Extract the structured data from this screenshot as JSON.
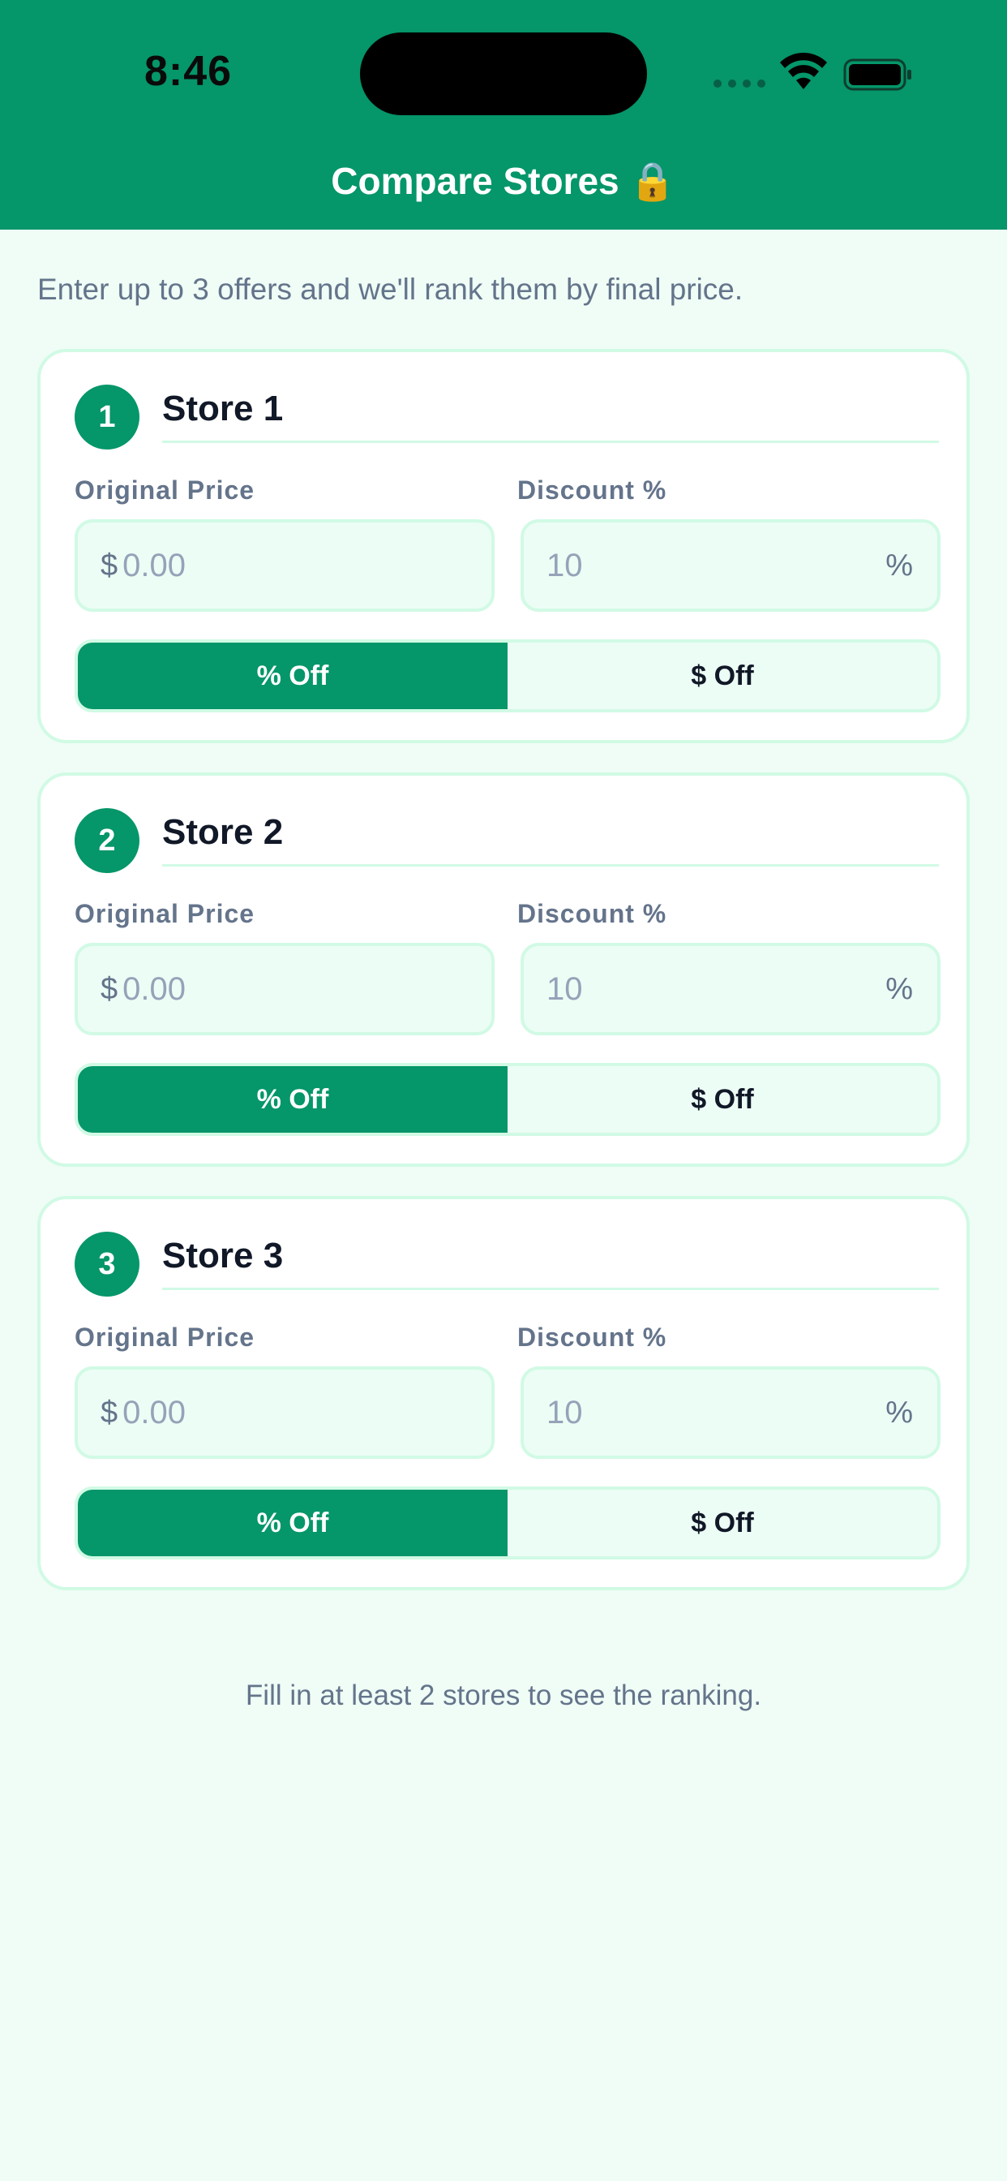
{
  "status_bar": {
    "time": "8:46"
  },
  "nav": {
    "title": "Compare Stores 🔒"
  },
  "intro": "Enter up to 3 offers and we'll rank them by final price.",
  "stores": [
    {
      "number": "1",
      "name": "Store 1",
      "price_label": "Original Price",
      "price_prefix": "$",
      "price_placeholder": "0.00",
      "discount_label": "Discount %",
      "discount_placeholder": "10",
      "discount_suffix": "%",
      "toggle": [
        "% Off",
        "$ Off"
      ],
      "selected_toggle": "% Off"
    },
    {
      "number": "2",
      "name": "Store 2",
      "price_label": "Original Price",
      "price_prefix": "$",
      "price_placeholder": "0.00",
      "discount_label": "Discount %",
      "discount_placeholder": "10",
      "discount_suffix": "%",
      "toggle": [
        "% Off",
        "$ Off"
      ],
      "selected_toggle": "% Off"
    },
    {
      "number": "3",
      "name": "Store 3",
      "price_label": "Original Price",
      "price_prefix": "$",
      "price_placeholder": "0.00",
      "discount_label": "Discount %",
      "discount_placeholder": "10",
      "discount_suffix": "%",
      "toggle": [
        "% Off",
        "$ Off"
      ],
      "selected_toggle": "% Off"
    }
  ],
  "footer_hint": "Fill in at least 2 stores to see the ranking.",
  "colors": {
    "primary": "#059669",
    "background": "#effdf6",
    "border": "#d1fae5",
    "muted_text": "#64748b"
  },
  "icons": {
    "signal": "cellular-signal-icon",
    "wifi": "wifi-icon",
    "battery": "battery-icon",
    "lock": "lock-icon"
  }
}
